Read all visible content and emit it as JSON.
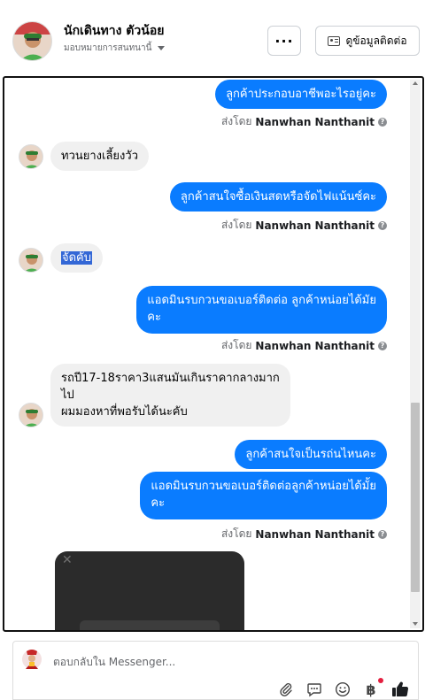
{
  "header": {
    "contact_name": "นักเดินทาง ตัวน้อย",
    "assign_label": "มอบหมายการสนทนานี้",
    "more_label": "···",
    "contact_button_label": "ดูข้อมูลติดต่อ"
  },
  "sender_name": "Nanwhan Nanthanit",
  "sent_by_prefix": "ส่งโดย",
  "messages": [
    {
      "dir": "out",
      "text": "ลูกค้าประกอบอาชีพอะไรอยู่คะ"
    },
    {
      "dir": "in",
      "text": "ทวนยางเลี้ยงวัว"
    },
    {
      "dir": "out",
      "text": "ลูกค้าสนใจซื้อเงินสดหรือจัดไฟแน้นซ์คะ"
    },
    {
      "dir": "in",
      "text": "จัดคับ"
    },
    {
      "dir": "out",
      "text_lines": [
        "แอดมินรบกวนขอเบอร์ติดต่อ ลูกค้าหน่อยได้มัย",
        "คะ"
      ]
    },
    {
      "dir": "in",
      "text_lines": [
        "รถปี17-18ราคา3แสนมันเกินราคากลางมาก",
        "ไป",
        "ผมมองหาที่พอรับได้นะคับ"
      ]
    },
    {
      "dir": "out",
      "text": "ลูกค้าสนใจเป็นรถ่นไหนคะ"
    },
    {
      "dir": "out",
      "text_lines": [
        "แอดมินรบกวนขอเบอร์ติดต่อลูกค้าหน่อยได้มั้ย",
        "คะ"
      ]
    }
  ],
  "composer": {
    "placeholder": "ตอบกลับใน Messenger..."
  },
  "colors": {
    "outgoing_bubble": "#0a7cff",
    "incoming_bubble": "#f0f0f0",
    "like_icon": "#1c1e21",
    "notification_dot": "#e41e3f"
  },
  "icons": {
    "attach": "paperclip-icon",
    "saved_replies": "chat-bubble-icon",
    "emoji": "smiley-icon",
    "payment": "baht-icon",
    "like": "thumbs-up-icon"
  }
}
